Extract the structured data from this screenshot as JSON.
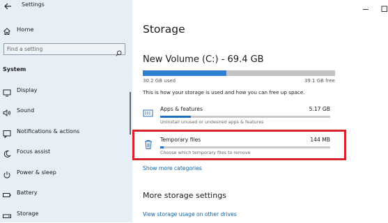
{
  "window": {
    "title": "Settings",
    "accent_color": "#2f7fce",
    "highlight_color": "#d9212c"
  },
  "sidebar": {
    "home_label": "Home",
    "search_placeholder": "Find a setting",
    "section_label": "System",
    "items": [
      {
        "label": "Display",
        "icon": "monitor-icon"
      },
      {
        "label": "Sound",
        "icon": "speaker-icon"
      },
      {
        "label": "Notifications & actions",
        "icon": "notification-icon"
      },
      {
        "label": "Focus assist",
        "icon": "moon-icon"
      },
      {
        "label": "Power & sleep",
        "icon": "power-icon"
      },
      {
        "label": "Battery",
        "icon": "battery-icon"
      },
      {
        "label": "Storage",
        "icon": "storage-icon"
      }
    ]
  },
  "main": {
    "title": "Storage",
    "drive": {
      "name": "New Volume (C:) - 69.4 GB",
      "used_label": "30.2 GB used",
      "free_label": "39.1 GB free",
      "used_fraction": 0.435
    },
    "description": "This is how your storage is used and how you can free up space.",
    "categories": [
      {
        "name": "Apps & features",
        "size": "5.17 GB",
        "subtitle": "Uninstall unused or undesired apps & features",
        "fill_fraction": 0.18,
        "icon": "apps-icon"
      },
      {
        "name": "Temporary files",
        "size": "144 MB",
        "subtitle": "Choose which temporary files to remove",
        "fill_fraction": 0.02,
        "icon": "trash-icon"
      }
    ],
    "show_more": "Show more categories",
    "more_settings_heading": "More storage settings",
    "view_usage_link": "View storage usage on other drives"
  }
}
